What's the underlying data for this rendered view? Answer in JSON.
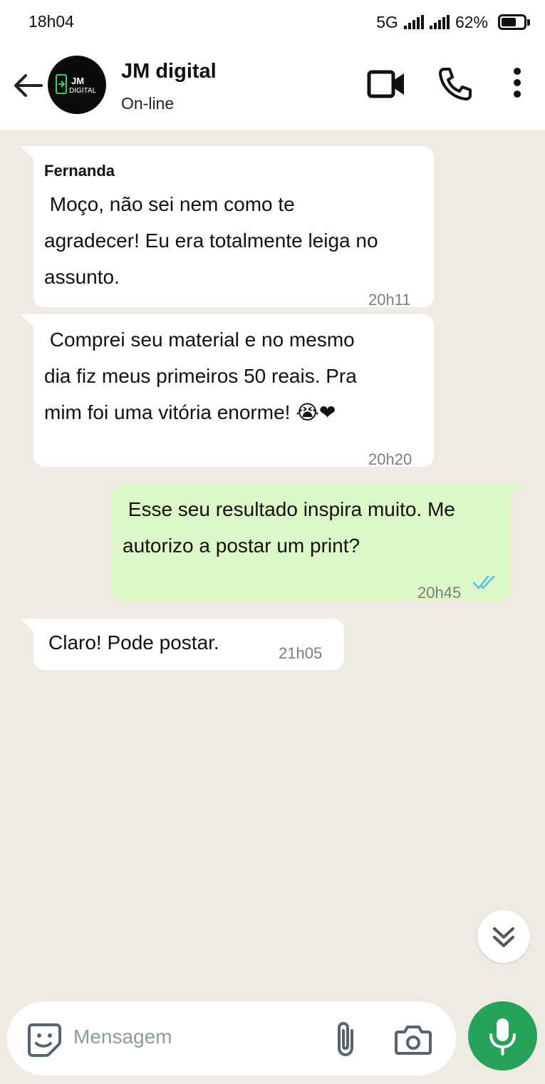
{
  "status_bar": {
    "time": "18h04",
    "network": "5G",
    "battery": "62%"
  },
  "header": {
    "contact_name": "JM digital",
    "contact_status": "On-line",
    "avatar_text_line1": "JM",
    "avatar_text_line2": "DIGITAL"
  },
  "messages": [
    {
      "direction": "incoming",
      "sender": "Fernanda",
      "lines": [
        " Moço, não sei nem como te",
        "agradecer! Eu era totalmente leiga no",
        "assunto."
      ],
      "time": "20h11"
    },
    {
      "direction": "incoming",
      "lines": [
        " Comprei seu material e no mesmo",
        "dia fiz meus primeiros 50 reais. Pra",
        "mim foi uma vitória enorme! 😭❤"
      ],
      "time": "20h20"
    },
    {
      "direction": "outgoing",
      "lines": [
        " Esse seu resultado inspira muito. Me",
        "autorizo a postar um print?"
      ],
      "time": "20h45",
      "read": true
    },
    {
      "direction": "incoming",
      "lines": [
        "Claro! Pode postar."
      ],
      "time": "21h05"
    }
  ],
  "composer": {
    "placeholder": "Mensagem"
  },
  "colors": {
    "chat_background": "#efeae2",
    "outgoing_bubble": "#dcf8c6",
    "incoming_bubble": "#ffffff",
    "mic_button": "#25a35a",
    "read_ticks": "#53bdeb"
  }
}
